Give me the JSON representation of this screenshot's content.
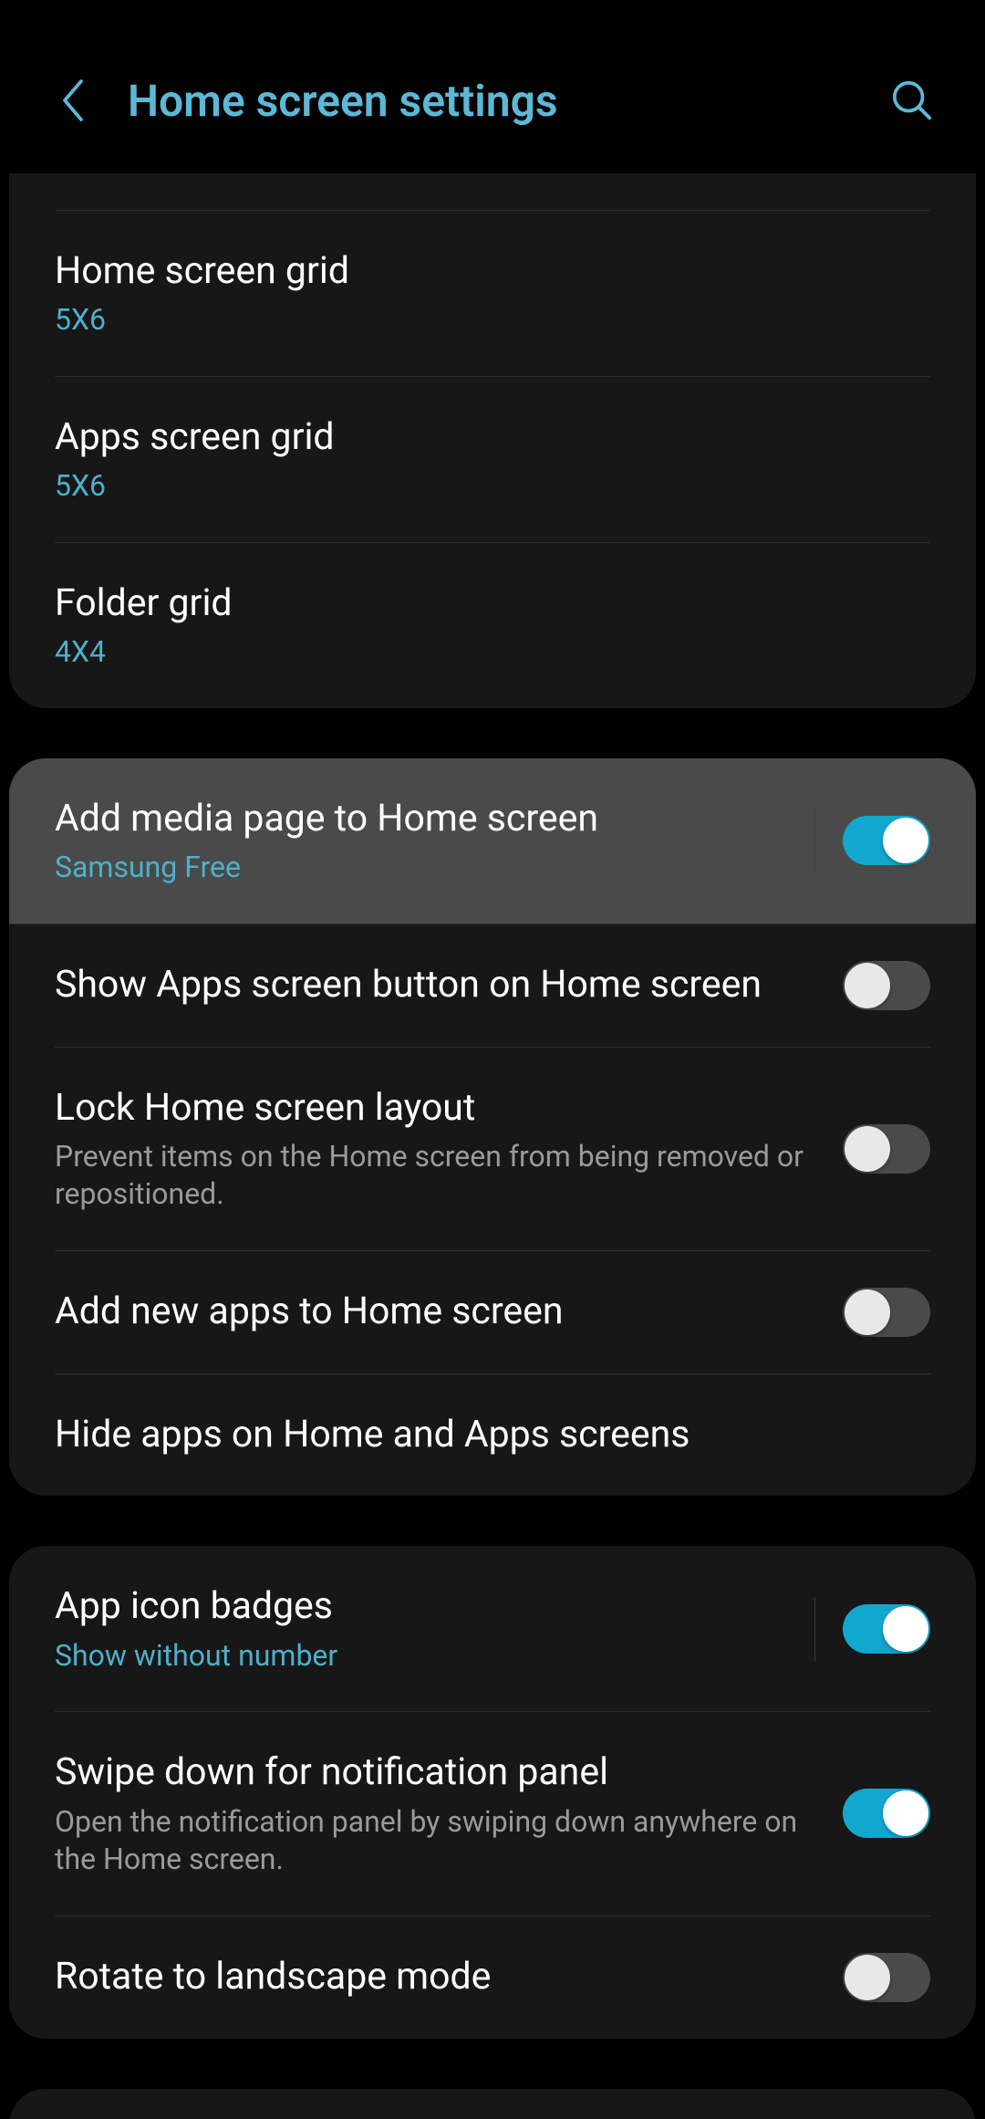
{
  "header": {
    "title": "Home screen settings"
  },
  "group1": {
    "home_grid": {
      "label": "Home screen grid",
      "value": "5X6"
    },
    "apps_grid": {
      "label": "Apps screen grid",
      "value": "5X6"
    },
    "folder_grid": {
      "label": "Folder grid",
      "value": "4X4"
    }
  },
  "group2": {
    "media_page": {
      "label": "Add media page to Home screen",
      "sub": "Samsung Free",
      "on": true
    },
    "show_apps_btn": {
      "label": "Show Apps screen button on Home screen",
      "on": false
    },
    "lock_layout": {
      "label": "Lock Home screen layout",
      "sub": "Prevent items on the Home screen from being removed or repositioned.",
      "on": false
    },
    "add_new_apps": {
      "label": "Add new apps to Home screen",
      "on": false
    },
    "hide_apps": {
      "label": "Hide apps on Home and Apps screens"
    }
  },
  "group3": {
    "badges": {
      "label": "App icon badges",
      "sub": "Show without number",
      "on": true
    },
    "swipe_notif": {
      "label": "Swipe down for notification panel",
      "sub": "Open the notification panel by swiping down anywhere on the Home screen.",
      "on": true
    },
    "rotate": {
      "label": "Rotate to landscape mode",
      "on": false
    }
  }
}
